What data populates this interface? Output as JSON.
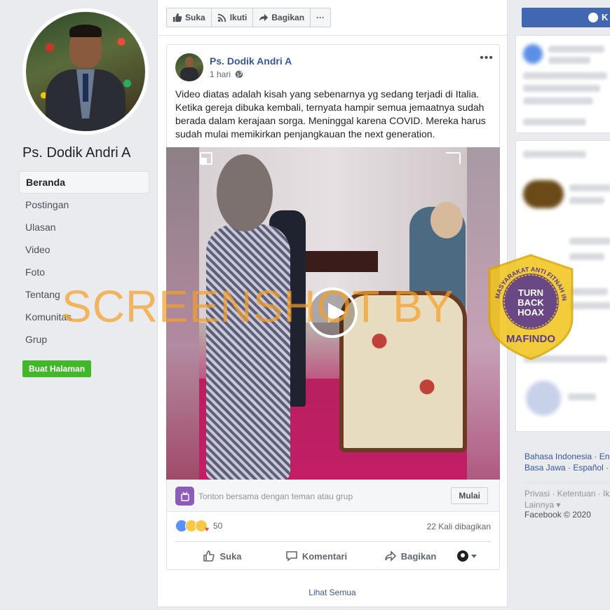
{
  "left": {
    "page_name": "Ps. Dodik Andri A",
    "nav": [
      "Beranda",
      "Postingan",
      "Ulasan",
      "Video",
      "Foto",
      "Tentang",
      "Komunitas",
      "Grup"
    ],
    "create_page": "Buat Halaman"
  },
  "action_bar": {
    "like": "Suka",
    "follow": "Ikuti",
    "share": "Bagikan",
    "more": "···"
  },
  "post": {
    "author": "Ps. Dodik Andri A",
    "time": "1 hari",
    "menu": "•••",
    "text": "Video diatas adalah kisah yang sebenarnya yg sedang terjadi di Italia. Ketika gereja dibuka kembali, ternyata hampir semua jemaatnya sudah berada dalam kerajaan sorga. Meninggal karena COVID. Mereka harus sudah mulai memikirkan penjangkauan the next generation.",
    "watch_party_text": "Tonton bersama dengan teman atau grup",
    "watch_party_button": "Mulai",
    "reaction_count": "50",
    "share_count": "22 Kali dibagikan",
    "actions": {
      "like": "Suka",
      "comment": "Komentari",
      "share": "Bagikan"
    }
  },
  "see_all": "Lihat Semua",
  "right": {
    "messenger_label": "K",
    "languages_line1": "Bahasa Indonesia · En",
    "languages_line2": "Basa Jawa · Español ·",
    "footer_line1": "Privasi · Ketentuan · Ik",
    "footer_line2": "Lainnya ▾",
    "copyright": "Facebook © 2020"
  },
  "watermark": {
    "text": "SCREENSHOT BY",
    "seal_top": "MASYARAKAT ANTI FITNAH INDONESIA",
    "seal_center": [
      "TURN",
      "BACK",
      "HOAX"
    ],
    "seal_bottom": "MAFINDO"
  },
  "colors": {
    "brand_blue": "#4267b2",
    "link_blue": "#365899",
    "green_button": "#42b72a",
    "background": "#e9ebee",
    "watermark_orange": "#f5a028",
    "seal_yellow": "#f0c419",
    "seal_purple": "#5b3a8c"
  }
}
